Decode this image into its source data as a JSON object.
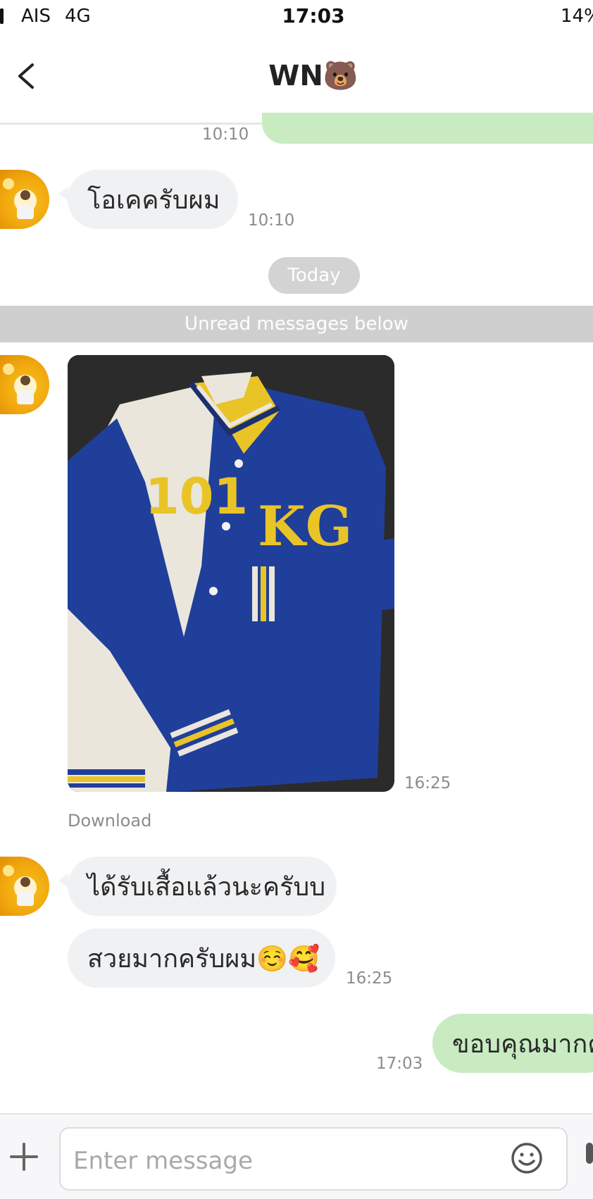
{
  "status_bar": {
    "carrier": "AIS",
    "network": "4G",
    "time": "17:03",
    "battery": "14%"
  },
  "header": {
    "title": "WN🐻"
  },
  "messages": [
    {
      "time": "10:10"
    },
    {
      "text": "โอเคครับผม",
      "time": "10:10"
    },
    {
      "date_divider": "Today"
    },
    {
      "unread_banner": "Unread messages below"
    },
    {
      "image_time": "16:25",
      "download_label": "Download"
    },
    {
      "text": "ได้รับเสื้อแล้วนะครับบ"
    },
    {
      "text": "สวยมากครับผม☺️🥰",
      "time": "16:25"
    },
    {
      "text": "ขอบคุณมากค",
      "time": "17:03"
    }
  ],
  "jacket": {
    "number": "101",
    "initials": "KG"
  },
  "composer": {
    "placeholder": "Enter message"
  },
  "colors": {
    "incoming_bubble": "#f0f1f3",
    "outgoing_bubble": "#c8ebc1",
    "jacket_blue": "#203f9a",
    "jacket_yellow": "#e9c427"
  }
}
